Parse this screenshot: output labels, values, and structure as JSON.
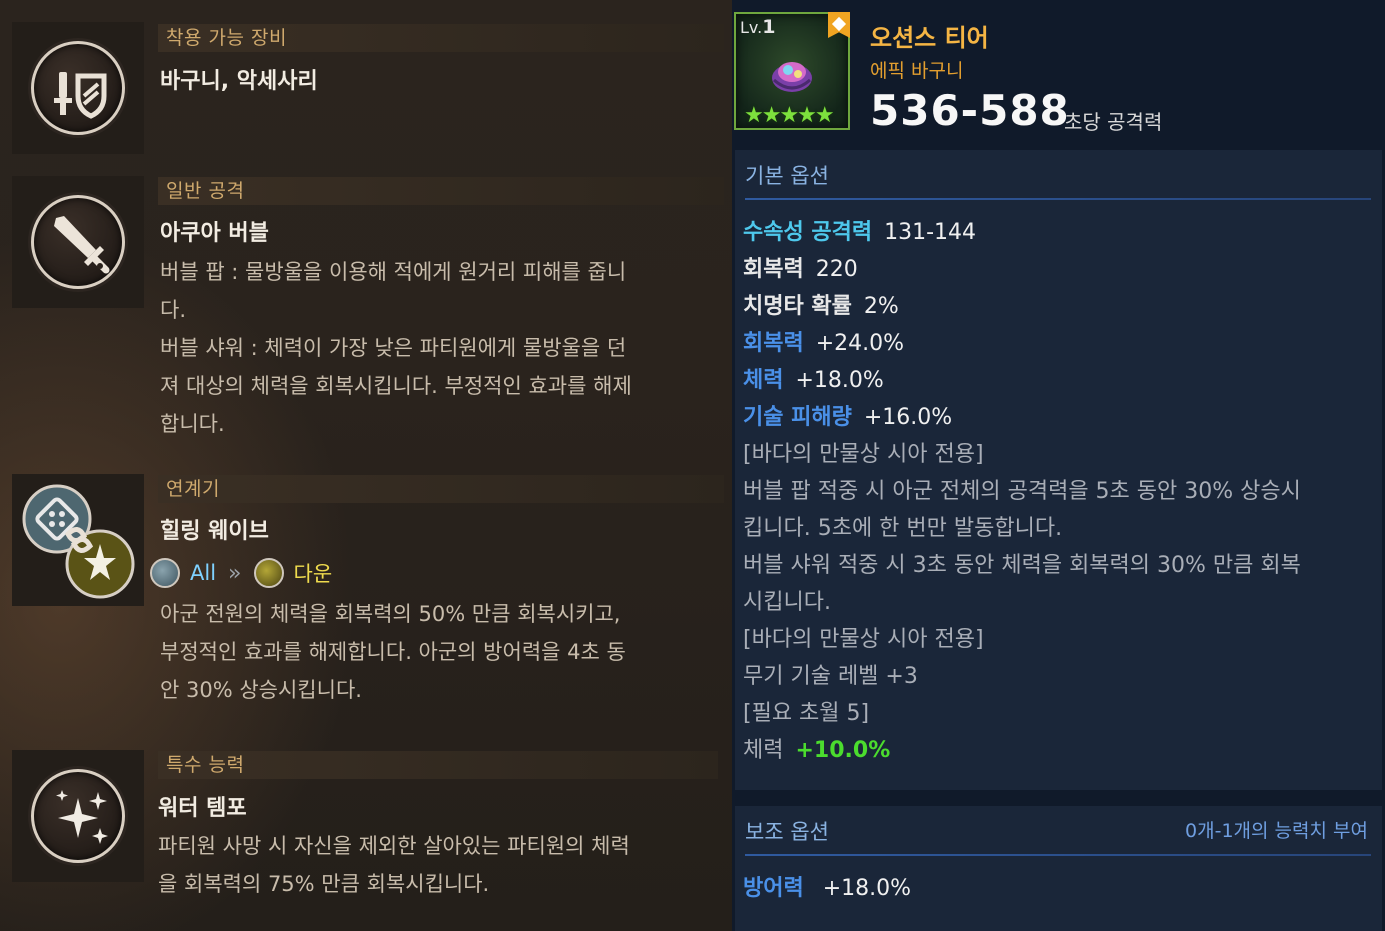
{
  "left": {
    "equip": {
      "header": "착용 가능 장비",
      "title": "바구니, 악세사리",
      "icon": "sword-shield-icon"
    },
    "normal_attack": {
      "header": "일반 공격",
      "title": "아쿠아 버블",
      "lines": [
        "버블 팝 : 물방울을 이용해 적에게 원거리 피해를 줍니",
        "다.",
        "버블 샤워 : 체력이 가장 낮은 파티원에게 물방울을 던",
        "져 대상의 체력을 회복시킵니다. 부정적인 효과를 해제",
        "합니다."
      ],
      "icon": "sword-icon"
    },
    "chain": {
      "header": "연계기",
      "title": "힐링 웨이브",
      "from_label": "All",
      "to_label": "다운",
      "lines": [
        "아군 전원의 체력을 회복력의 50% 만큼 회복시키고,",
        "부정적인 효과를 해제합니다. 아군의 방어력을 4초 동",
        "안 30% 상승시킵니다."
      ],
      "icon": "chain-link-icon"
    },
    "special": {
      "header": "특수 능력",
      "title": "워터 템포",
      "lines": [
        "파티원 사망 시 자신을 제외한 살아있는 파티원의 체력",
        "을 회복력의 75% 만큼 회복시킵니다."
      ],
      "icon": "sparkle-icon"
    }
  },
  "item": {
    "level_prefix": "Lv.",
    "level": "1",
    "stars": "★★★★★",
    "name": "오션스 티어",
    "type": "에픽 바구니",
    "attack": "536-588",
    "attack_label": "초당 공격력",
    "rarity_color": "#6fa73e"
  },
  "base_options": {
    "header": "기본 옵션",
    "lines": [
      {
        "key": "수속성 공격력",
        "value": "131-144",
        "style": "k-cyan"
      },
      {
        "key": "회복력",
        "value": "220",
        "style": "k-white"
      },
      {
        "key": "치명타 확률",
        "value": "2%",
        "style": "k-white"
      },
      {
        "key": "회복력",
        "value": "+24.0%",
        "style": "k-blue"
      },
      {
        "key": "체력",
        "value": "+18.0%",
        "style": "k-blue"
      },
      {
        "key": "기술 피해량",
        "value": "+16.0%",
        "style": "k-blue"
      },
      {
        "text": "[바다의 만물상 시아 전용]"
      },
      {
        "text": "버블 팝 적중 시 아군 전체의 공격력을 5초 동안 30% 상승시"
      },
      {
        "text": "킵니다. 5초에 한 번만 발동합니다."
      },
      {
        "text": "버블 샤워 적중 시 3초 동안 체력을 회복력의 30% 만큼 회복"
      },
      {
        "text": "시킵니다."
      },
      {
        "text": "[바다의 만물상 시아 전용]"
      },
      {
        "text": "무기 기술 레벨 +3"
      },
      {
        "text": "[필요 초월 5]"
      },
      {
        "key": "체력",
        "value": "+10.0%",
        "style": "k-gray",
        "value_style": "v-green"
      }
    ]
  },
  "sub_options": {
    "header": "보조 옵션",
    "right_note": "0개-1개의 능력치 부여",
    "line_key": "방어력",
    "line_value": "+18.0%"
  }
}
